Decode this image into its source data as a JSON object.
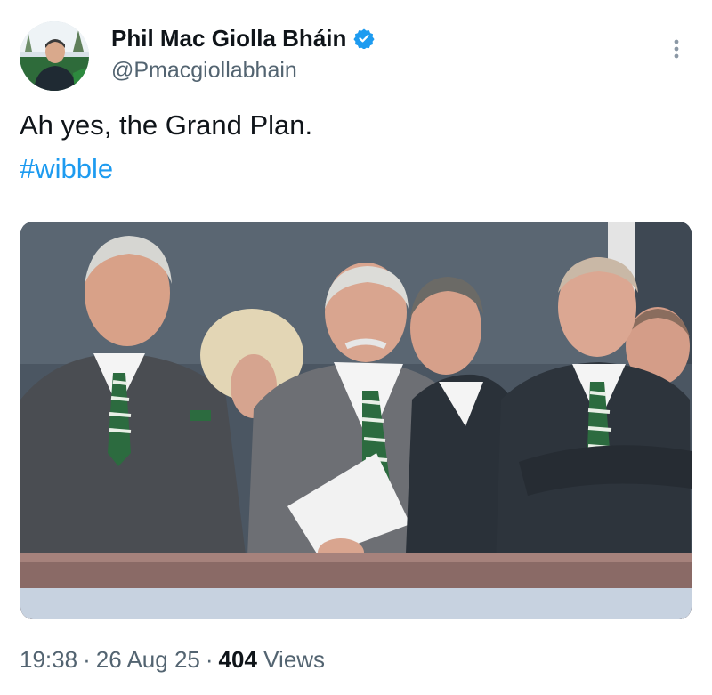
{
  "author": {
    "display_name": "Phil Mac Giolla Bháin",
    "handle": "@Pmacgiollabhain",
    "verified": true,
    "verified_color": "#1d9bf0"
  },
  "tweet": {
    "text": "Ah yes, the Grand Plan.",
    "hashtag": "#wibble",
    "hashtag_color": "#1d9bf0"
  },
  "meta": {
    "time": "19:38",
    "date": "26 Aug 25",
    "separator": "·",
    "views_count": "404",
    "views_label": "Views"
  },
  "icons": {
    "verified": "verified-badge-icon",
    "more": "more-options-icon"
  }
}
